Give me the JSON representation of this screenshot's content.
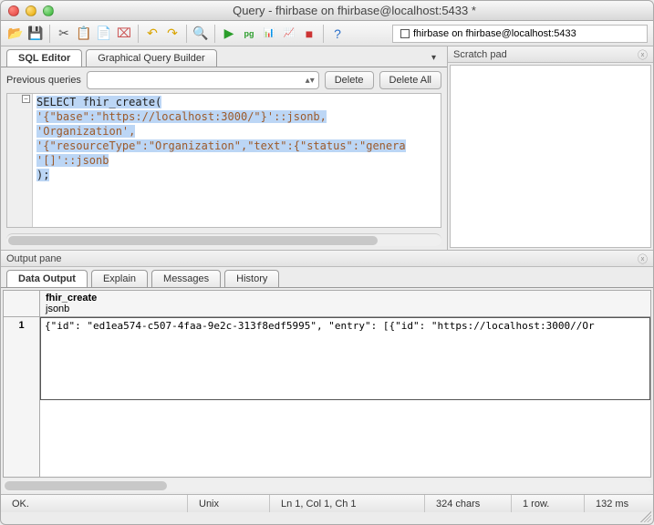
{
  "window": {
    "title": "Query - fhirbase on fhirbase@localhost:5433 *"
  },
  "toolbar": {
    "connection": "fhirbase on fhirbase@localhost:5433"
  },
  "editor_tabs": {
    "sql": "SQL Editor",
    "gqb": "Graphical Query Builder"
  },
  "previous": {
    "label": "Previous queries",
    "delete": "Delete",
    "delete_all": "Delete All"
  },
  "code": {
    "l1a": "SELECT",
    "l1b": " fhir_create(",
    "l2": "'{\"base\":\"https://localhost:3000/\"}'::jsonb,",
    "l3": "'Organization',",
    "l4": "'{\"resourceType\":\"Organization\",\"text\":{\"status\":\"genera",
    "l5": "'[]'::jsonb",
    "l6": ");"
  },
  "scratch": {
    "title": "Scratch pad"
  },
  "output": {
    "pane_title": "Output pane",
    "tabs": {
      "data": "Data Output",
      "explain": "Explain",
      "messages": "Messages",
      "history": "History"
    },
    "column": {
      "name": "fhir_create",
      "type": "jsonb"
    },
    "row1_num": "1",
    "row1_val": "{\"id\": \"ed1ea574-c507-4faa-9e2c-313f8edf5995\", \"entry\": [{\"id\": \"https://localhost:3000//Or"
  },
  "status": {
    "ok": "OK.",
    "enc": "Unix",
    "pos": "Ln 1, Col 1, Ch 1",
    "chars": "324 chars",
    "rows": "1 row.",
    "time": "132 ms"
  }
}
